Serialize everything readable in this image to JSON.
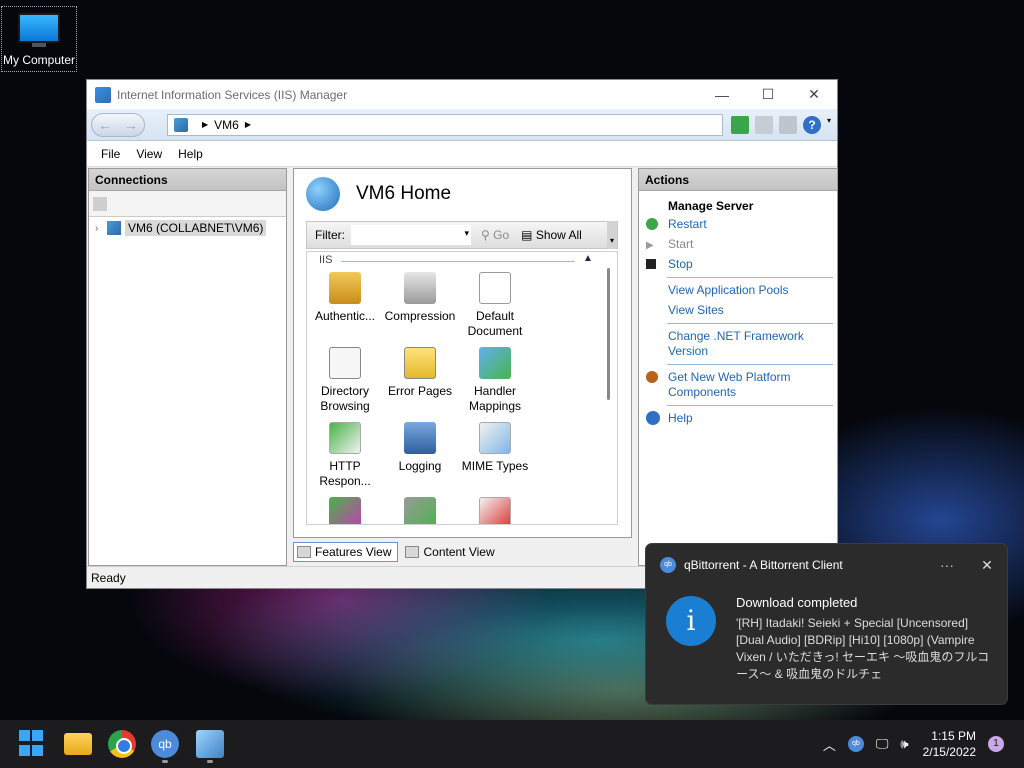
{
  "desktop": {
    "icon_label": "My Computer"
  },
  "iis": {
    "title": "Internet Information Services (IIS) Manager",
    "address": "VM6",
    "menu": [
      "File",
      "View",
      "Help"
    ],
    "connections": {
      "header": "Connections",
      "node": "VM6 (COLLABNET\\VM6)"
    },
    "home": {
      "title": "VM6 Home",
      "filter_label": "Filter:",
      "go_label": "Go",
      "show_all_label": "Show All",
      "group_label": "IIS",
      "features": [
        {
          "label": "Authentic..."
        },
        {
          "label": "Compression"
        },
        {
          "label": "Default Document"
        },
        {
          "label": "Directory Browsing"
        },
        {
          "label": "Error Pages"
        },
        {
          "label": "Handler Mappings"
        },
        {
          "label": "HTTP Respon..."
        },
        {
          "label": "Logging"
        },
        {
          "label": "MIME Types"
        }
      ]
    },
    "tabs": {
      "features_view": "Features View",
      "content_view": "Content View"
    },
    "actions": {
      "header": "Actions",
      "section": "Manage Server",
      "restart": "Restart",
      "start": "Start",
      "stop": "Stop",
      "view_app_pools": "View Application Pools",
      "view_sites": "View Sites",
      "change_net": "Change .NET Framework Version",
      "get_web_platform": "Get New Web Platform Components",
      "help": "Help"
    },
    "status": "Ready"
  },
  "notification": {
    "app": "qBittorrent - A Bittorrent Client",
    "title": "Download completed",
    "body": "'[RH] Itadaki! Seieki + Special [Uncensored] [Dual Audio] [BDRip] [Hi10] [1080p] (Vampire Vixen / いただきっ! セーエキ ～吸血鬼のフルコース～ & 吸血鬼のドルチェ"
  },
  "taskbar": {
    "qb_label": "qb",
    "time": "1:15 PM",
    "date": "2/15/2022",
    "notification_count": "1"
  }
}
